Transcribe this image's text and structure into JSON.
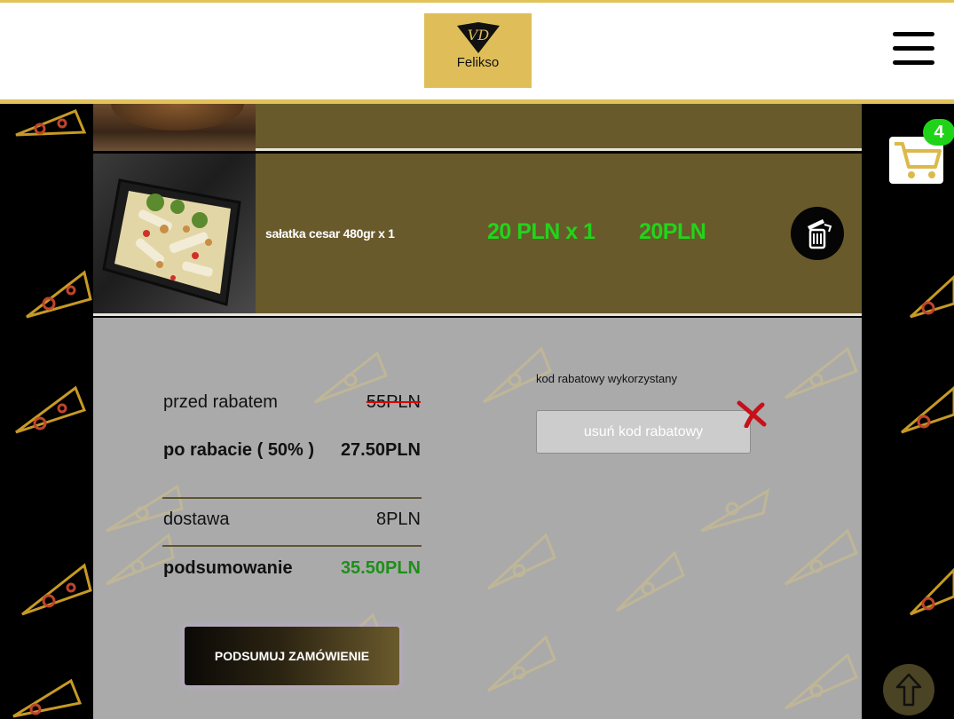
{
  "header": {
    "logo_initials": "VD",
    "logo_name": "Felikso",
    "menu_icon": "hamburger-icon"
  },
  "cart": {
    "count": "4",
    "icon": "cart-icon"
  },
  "order_items": [
    {
      "name": "sałatka cesar 480gr x 1",
      "unit_price": "20 PLN x 1",
      "total": "20PLN",
      "remove_icon": "trash-icon"
    }
  ],
  "summary": {
    "before_discount_label": "przed rabatem",
    "before_discount_value": "55PLN",
    "after_discount_label": "po rabacie ( 50% )",
    "after_discount_value": "27.50PLN",
    "delivery_label": "dostawa",
    "delivery_value": "8PLN",
    "total_label": "podsumowanie",
    "total_value": "35.50PLN",
    "checkout_button": "PODSUMUJ ZAMÓWIENIE"
  },
  "coupon": {
    "status_label": "kod rabatowy wykorzystany",
    "remove_button": "usuń kod rabatowy",
    "remove_icon": "close-x-icon"
  },
  "scroll_top_icon": "arrow-up-icon",
  "colors": {
    "gold": "#dfbe59",
    "item_row": "#695a2c",
    "summary_bg": "#aaaaaa",
    "price_green": "#22d41a",
    "total_green": "#1e8f1a",
    "strike_red": "#e00000"
  }
}
